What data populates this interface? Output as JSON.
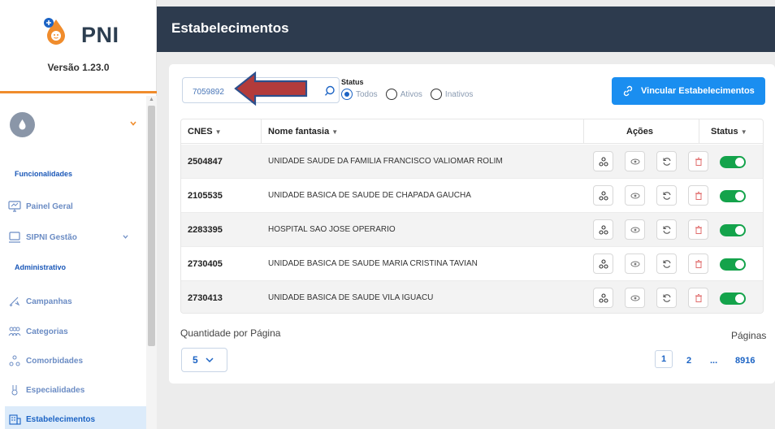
{
  "app": {
    "name": "PNI",
    "version": "Versão 1.23.0"
  },
  "sidebar": {
    "sections": [
      {
        "title": "Funcionalidades"
      },
      {
        "title": "Administrativo"
      }
    ],
    "items": [
      {
        "label": "Painel Geral",
        "icon": "dashboard-icon"
      },
      {
        "label": "SIPNI Gestão",
        "icon": "monitor-icon"
      },
      {
        "label": "Campanhas",
        "icon": "megaphone-icon"
      },
      {
        "label": "Categorias",
        "icon": "people-icon"
      },
      {
        "label": "Comorbidades",
        "icon": "comorbidity-icon"
      },
      {
        "label": "Especialidades",
        "icon": "medal-icon"
      },
      {
        "label": "Estabelecimentos",
        "icon": "building-icon"
      }
    ]
  },
  "header": {
    "title": "Estabelecimentos"
  },
  "filters": {
    "search_value": "7059892",
    "status_label": "Status",
    "status_options": [
      "Todos",
      "Ativos",
      "Inativos"
    ],
    "selected_status": "Todos"
  },
  "actions": {
    "link_button": "Vincular Estabelecimentos"
  },
  "table": {
    "columns": [
      "CNES",
      "Nome fantasia",
      "Ações",
      "Status"
    ],
    "rows": [
      {
        "cnes": "2504847",
        "name": "UNIDADE SAUDE DA FAMILIA FRANCISCO VALIOMAR ROLIM",
        "active": true
      },
      {
        "cnes": "2105535",
        "name": "UNIDADE BASICA DE SAUDE DE CHAPADA GAUCHA",
        "active": true
      },
      {
        "cnes": "2283395",
        "name": "HOSPITAL SAO JOSE OPERARIO",
        "active": true
      },
      {
        "cnes": "2730405",
        "name": "UNIDADE BASICA DE SAUDE MARIA CRISTINA TAVIAN",
        "active": true
      },
      {
        "cnes": "2730413",
        "name": "UNIDADE BASICA DE SAUDE VILA IGUACU",
        "active": true
      }
    ]
  },
  "pagination": {
    "per_page_label": "Quantidade por Página",
    "per_page_value": "5",
    "pages_label": "Páginas",
    "pages": [
      "1",
      "2",
      "...",
      "8916"
    ],
    "current_page": "1"
  },
  "colors": {
    "header_bg": "#2d3b4e",
    "primary": "#1a8ef0",
    "active_toggle": "#14a34b",
    "accent_orange": "#f08c2c"
  }
}
